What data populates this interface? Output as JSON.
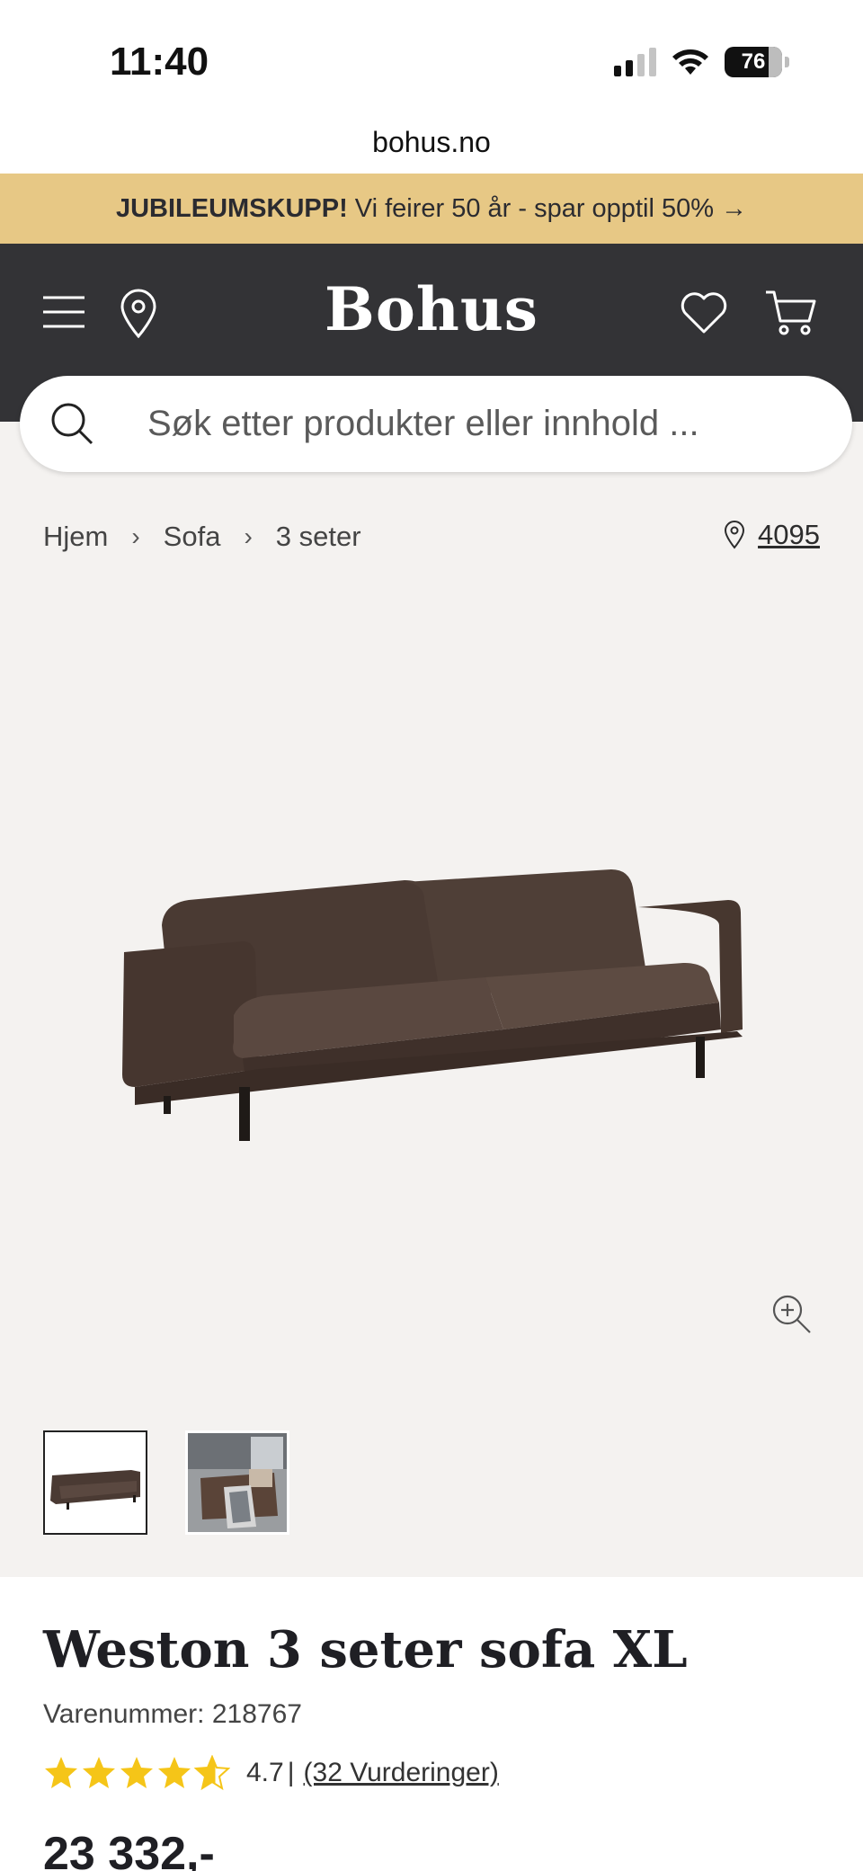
{
  "status": {
    "time": "11:40",
    "battery": "76"
  },
  "browser": {
    "url": "bohus.no"
  },
  "promo": {
    "bold": "JUBILEUMSKUPP!",
    "text": "Vi feirer 50 år - spar opptil 50% →"
  },
  "header": {
    "logo": "Bohus"
  },
  "search": {
    "placeholder": "Søk etter produkter eller innhold ..."
  },
  "breadcrumb": {
    "items": [
      "Hjem",
      "Sofa",
      "3 seter"
    ]
  },
  "store": {
    "number": "4095"
  },
  "product": {
    "title": "Weston 3 seter sofa XL",
    "sku": "Varenummer: 218767",
    "rating": 4.7,
    "rating_text": "4.7",
    "rating_sep": "|",
    "reviews": "(32 Vurderinger)",
    "price": "23 332,-"
  },
  "colors": {
    "promo": "#e7c885",
    "header": "#333336",
    "gallery": "#f4f2f0",
    "star": "#f5c518"
  },
  "icons": [
    "menu-icon",
    "location-pin-icon",
    "heart-icon",
    "cart-icon",
    "search-icon",
    "chevron-right-icon",
    "zoom-in-icon",
    "star-icon"
  ]
}
